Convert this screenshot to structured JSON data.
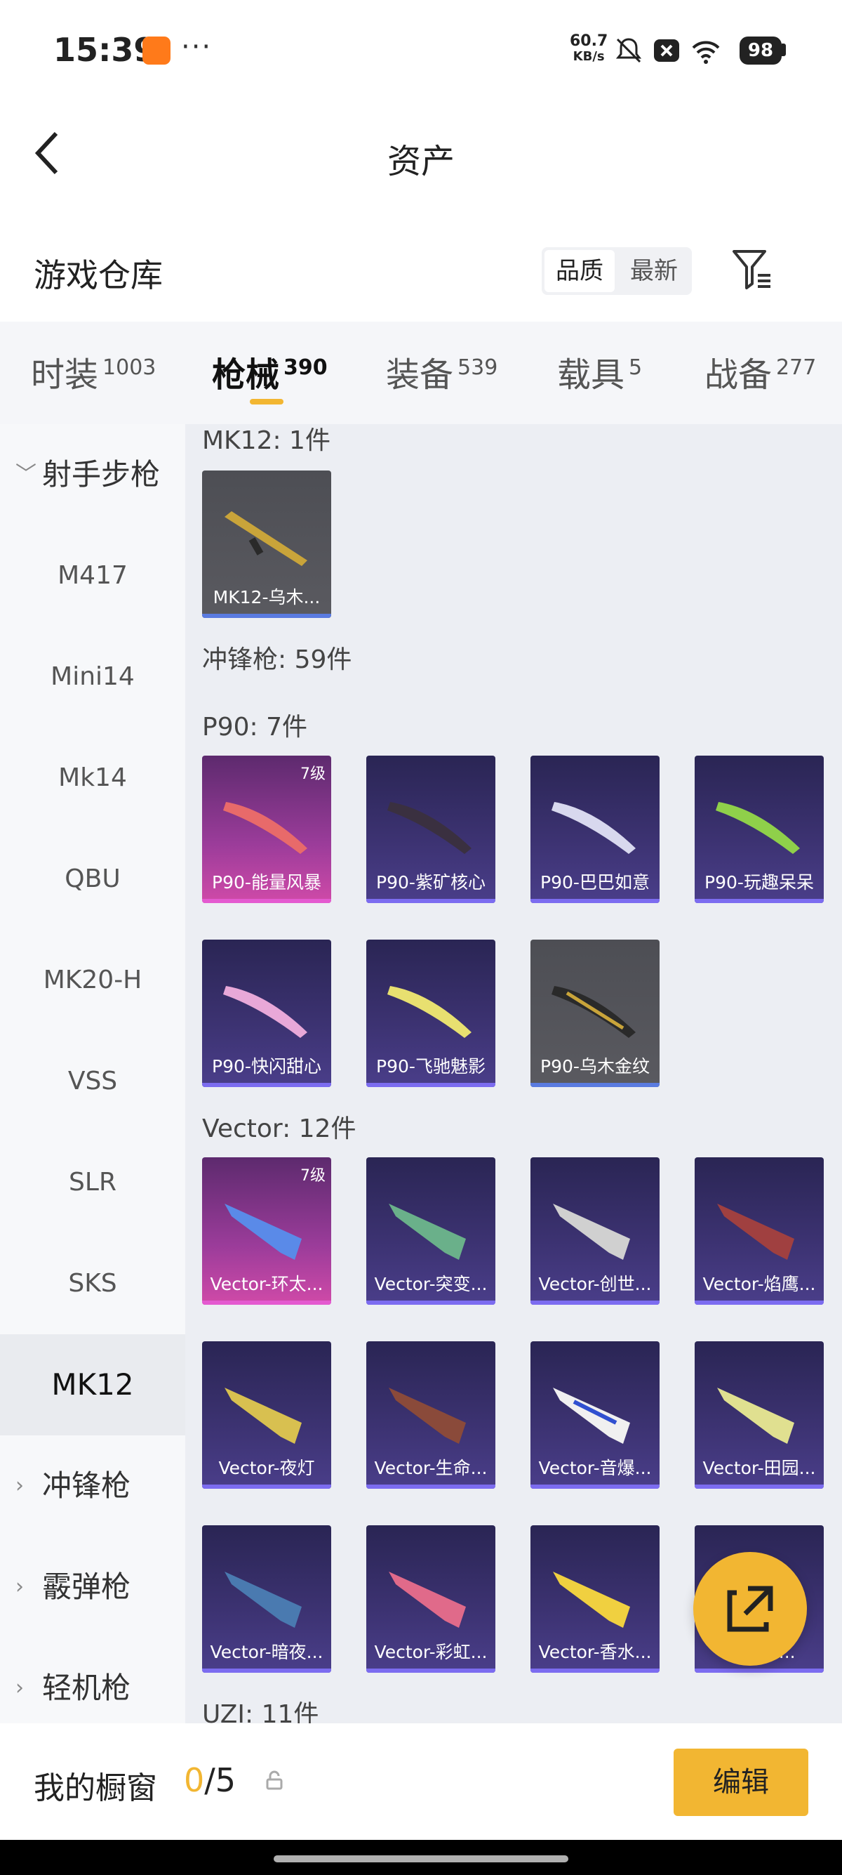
{
  "status_bar": {
    "time": "15:39",
    "net_speed": "60.7",
    "net_unit": "KB/s",
    "battery": "98",
    "more": "···"
  },
  "header": {
    "title": "资产"
  },
  "warehouse": {
    "title": "游戏仓库",
    "sort_quality": "品质",
    "sort_newest": "最新"
  },
  "tabs": [
    {
      "label": "时装",
      "count": "1003"
    },
    {
      "label": "枪械",
      "count": "390"
    },
    {
      "label": "装备",
      "count": "539"
    },
    {
      "label": "载具",
      "count": "5"
    },
    {
      "label": "战备",
      "count": "277"
    }
  ],
  "sidebar": {
    "group_marksman": "射手步枪",
    "items": [
      "M417",
      "Mini14",
      "Mk14",
      "QBU",
      "MK20-H",
      "VSS",
      "SLR",
      "SKS",
      "MK12"
    ],
    "group_smg": "冲锋枪",
    "group_shotgun": "霰弹枪",
    "group_lmg": "轻机枪"
  },
  "content": {
    "mk12_heading": "MK12: 1件",
    "mk12_items": [
      "MK12-乌木..."
    ],
    "smg_heading": "冲锋枪: 59件",
    "p90_heading": "P90: 7件",
    "p90_items": [
      "P90-能量风暴",
      "P90-紫矿核心",
      "P90-巴巴如意",
      "P90-玩趣呆呆",
      "P90-快闪甜心",
      "P90-飞驰魅影",
      "P90-乌木金纹"
    ],
    "vector_heading": "Vector: 12件",
    "vector_items": [
      "Vector-环太...",
      "Vector-突变...",
      "Vector-创世...",
      "Vector-焰鹰...",
      "Vector-夜灯",
      "Vector-生命...",
      "Vector-音爆...",
      "Vector-田园...",
      "Vector-暗夜...",
      "Vector-彩虹...",
      "Vector-香水...",
      "Ve...恩..."
    ],
    "uzi_heading": "UZI: 11件",
    "level_badge": "7级"
  },
  "bottom": {
    "label": "我的橱窗",
    "current": "0",
    "total": "/5",
    "edit": "编辑"
  },
  "colors": {
    "accent": "#f2b632",
    "purple_card": "#3d3373",
    "pink_card": "#9b3c9a",
    "gold_card": "#55565c"
  }
}
